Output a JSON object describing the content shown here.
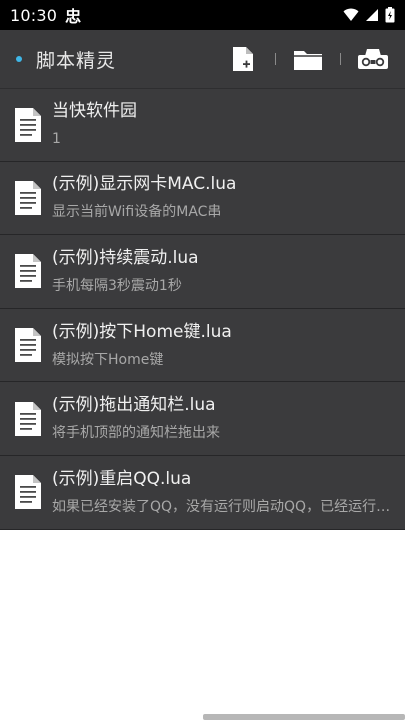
{
  "status_bar": {
    "time": "10:30",
    "app_icon": "忠",
    "icons": [
      "wifi-icon",
      "signal-icon",
      "battery-icon"
    ]
  },
  "app_bar": {
    "title": "脚本精灵",
    "actions": [
      "new-file-icon",
      "open-folder-icon",
      "recorder-icon"
    ],
    "accent_color": "#3fb7e8"
  },
  "scripts": [
    {
      "title": "当快软件园",
      "subtitle": "1"
    },
    {
      "title": "(示例)显示网卡MAC.lua",
      "subtitle": "显示当前Wifi设备的MAC串"
    },
    {
      "title": "(示例)持续震动.lua",
      "subtitle": "手机每隔3秒震动1秒"
    },
    {
      "title": "(示例)按下Home键.lua",
      "subtitle": "模拟按下Home键"
    },
    {
      "title": "(示例)拖出通知栏.lua",
      "subtitle": "将手机顶部的通知栏拖出来"
    },
    {
      "title": "(示例)重启QQ.lua",
      "subtitle": "如果已经安装了QQ，没有运行则启动QQ，已经运行则重启QQ"
    }
  ]
}
